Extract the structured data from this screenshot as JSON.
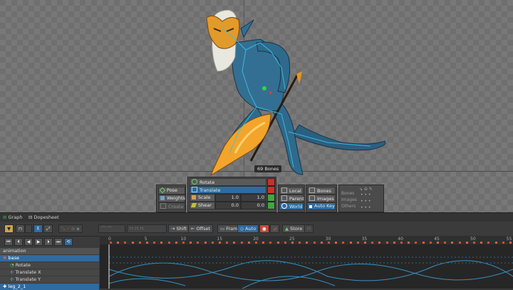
{
  "viewport": {
    "tooltip": "69 Bones"
  },
  "tools": {
    "pose": "Pose",
    "weights": "Weights",
    "create": "Create"
  },
  "transform": {
    "rotate": "Rotate",
    "translate": "Translate",
    "scale": "Scale",
    "shear": "Shear",
    "scale_x": "1.0",
    "scale_y": "1.0",
    "shear_x": "0.0",
    "shear_y": "0.0"
  },
  "axes": {
    "local": "Local",
    "parent": "Parent",
    "world": "World"
  },
  "display": {
    "bones": "Bones",
    "images": "Images",
    "auto_key": "Auto Key"
  },
  "visibility": {
    "bones": "Bones",
    "images": "Images",
    "others": "Others"
  },
  "tabs": {
    "graph": "Graph",
    "dopesheet": "Dopesheet"
  },
  "toolbar": {
    "shift": "Shift",
    "offset": "Offset",
    "frame": "Frame",
    "auto": "Auto",
    "store": "Store"
  },
  "ruler": {
    "ticks": [
      "0",
      "5",
      "10",
      "15",
      "20",
      "25",
      "30",
      "35",
      "40",
      "45",
      "50",
      "55"
    ]
  },
  "tree": {
    "animation": "animation",
    "base": "base",
    "rotate": "Rotate",
    "translate_x": "Translate X",
    "translate_y": "Translate Y",
    "leg": "leg_2_1"
  },
  "colors": {
    "accent_blue": "#2f6aa0",
    "key_green": "#3fa83f",
    "key_red": "#c8302a",
    "curve": "#3a8fc0"
  }
}
